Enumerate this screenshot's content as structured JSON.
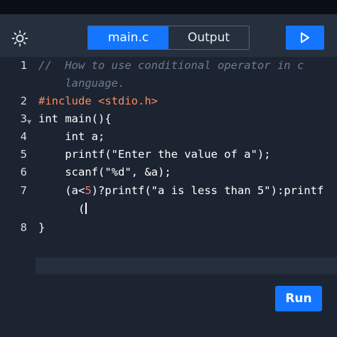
{
  "toolbar": {
    "theme_icon": "sun-icon",
    "tabs": [
      {
        "label": "main.c",
        "active": true
      },
      {
        "label": "Output",
        "active": false
      }
    ],
    "play_icon": "play-icon"
  },
  "editor": {
    "line_numbers": [
      "1",
      "2",
      "3",
      "4",
      "5",
      "6",
      "7",
      "8"
    ],
    "lines": {
      "l1a": "//  How to use conditional operator in c",
      "l1b": "    language.",
      "l2_directive": "#include",
      "l2_header": "<stdio.h>",
      "l3": "int main(){",
      "l4": "    int a;",
      "l5_fn": "    printf(",
      "l5_str": "\"Enter the value of a\"",
      "l5_end": ");",
      "l6_fn": "    scanf(",
      "l6_str": "\"%d\"",
      "l6_end": ", &a);",
      "l7_a": "    (a<",
      "l7_num": "5",
      "l7_b": ")?printf(",
      "l7_str": "\"a is less than 5\"",
      "l7_c": "):printf",
      "l7_wrap": "      (",
      "l8": "}"
    }
  },
  "run_button": {
    "label": "Run"
  },
  "colors": {
    "accent": "#1476ff",
    "editor_bg": "#1c2431",
    "toolbar_bg": "#262f3d",
    "comment": "#6f7b8f",
    "preprocessor": "#ff8a5c",
    "number": "#ff6f6f"
  }
}
